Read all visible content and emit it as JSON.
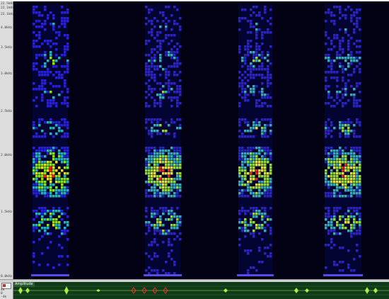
{
  "window": {
    "title": "",
    "colors": {
      "spectrogram_background": "#020214",
      "low_energy": "#2a22d0",
      "mid_energy": "#8fe01c",
      "high_energy": "#ff1e10",
      "amplitude_background": "#113a18",
      "amplitude_trace": "#b8ff48",
      "marker": "#ff2a2a"
    }
  },
  "frequency_axis": {
    "labels": [
      "22.5kHz",
      "22.1kHz",
      "22.1kHz",
      "4.0kHz",
      "3.5kHz",
      "3.0kHz",
      "2.5kHz",
      "2.0kHz",
      "1.5kHz",
      "0.0kHz"
    ]
  },
  "amplitude_panel": {
    "title": "Amplitude",
    "axis_labels": [
      "4k",
      "0",
      "-4k"
    ],
    "legend_icon": "amplitude-legend-icon",
    "marker_icon": "diamond-marker-icon"
  }
}
